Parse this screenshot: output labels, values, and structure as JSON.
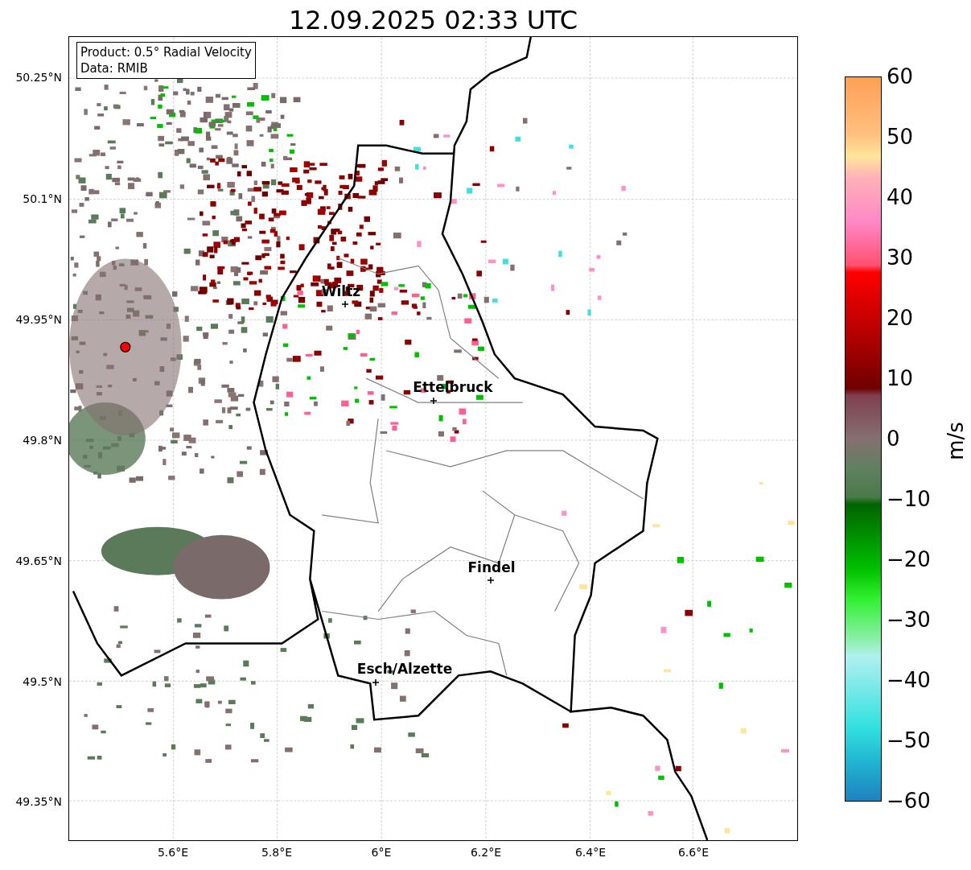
{
  "title": "12.09.2025 02:33 UTC",
  "info_box": {
    "lines": [
      "Product: 0.5° Radial Velocity",
      "Data: RMIB"
    ]
  },
  "lat_ticks": [
    "50.25°N",
    "50.1°N",
    "49.95°N",
    "49.8°N",
    "49.65°N",
    "49.5°N",
    "49.35°N"
  ],
  "lon_ticks": [
    "5.6°E",
    "5.8°E",
    "6°E",
    "6.2°E",
    "6.4°E",
    "6.6°E"
  ],
  "cities": [
    {
      "name": "Wiltz"
    },
    {
      "name": "Ettelbruck"
    },
    {
      "name": "Findel"
    },
    {
      "name": "Esch/Alzette"
    }
  ],
  "colorbar": {
    "label": "m/s",
    "ticks": [
      "60",
      "50",
      "40",
      "30",
      "20",
      "10",
      "0",
      "−10",
      "−20",
      "−30",
      "−40",
      "−50",
      "−60"
    ]
  }
}
